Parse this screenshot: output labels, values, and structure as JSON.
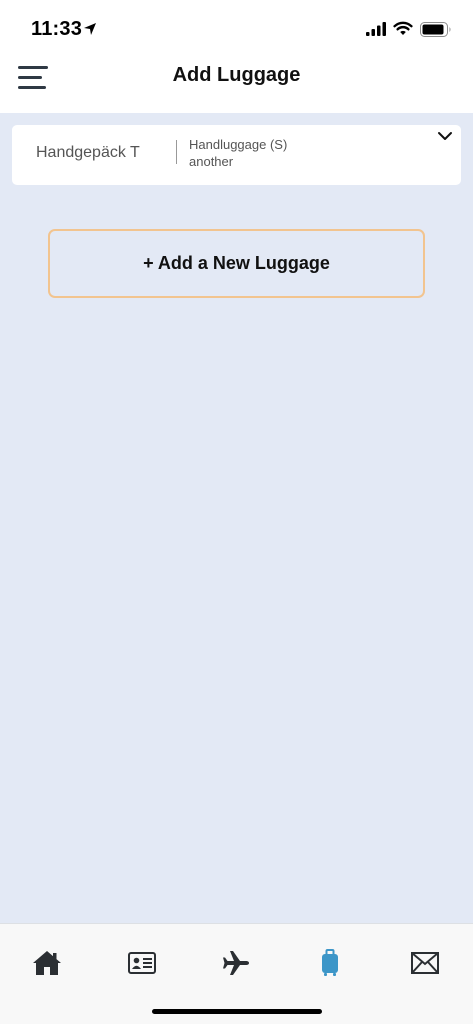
{
  "status_bar": {
    "time": "11:33"
  },
  "header": {
    "title": "Add Luggage",
    "menu_icon": "hamburger-menu-icon"
  },
  "luggage_items": [
    {
      "name": "Handgepäck T",
      "type": "Handluggage (S)",
      "subtitle": "another"
    }
  ],
  "add_button": {
    "label": "+ Add a New Luggage"
  },
  "tab_bar": {
    "tabs": [
      {
        "icon": "home-icon",
        "active": false
      },
      {
        "icon": "id-card-icon",
        "active": false
      },
      {
        "icon": "airplane-icon",
        "active": false
      },
      {
        "icon": "luggage-icon",
        "active": true
      },
      {
        "icon": "envelope-icon",
        "active": false
      }
    ]
  },
  "colors": {
    "background": "#e3e9f5",
    "accent_border": "#f2c48f",
    "active_tab": "#3d96c8",
    "inactive_tab": "#2b2f33"
  }
}
